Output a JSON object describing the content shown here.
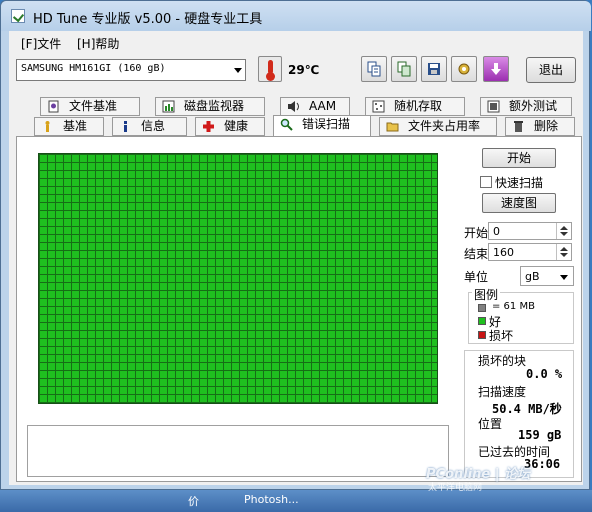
{
  "window": {
    "title": "HD Tune 专业版 v5.00 - 硬盘专业工具"
  },
  "menu": [
    {
      "label": "[F]文件"
    },
    {
      "label": "[H]帮助"
    }
  ],
  "toolbar": {
    "drive": "SAMSUNG HM161GI (160 gB)",
    "temperature": "29℃",
    "exit_label": "退出",
    "icons": [
      "copy-text-icon",
      "copy-screenshot-icon",
      "save-icon",
      "settings-icon",
      "download-icon"
    ]
  },
  "tabs": {
    "row1": [
      {
        "label": "文件基准",
        "icon": "file-benchmark-icon"
      },
      {
        "label": "磁盘监视器",
        "icon": "disk-monitor-icon"
      },
      {
        "label": "AAM",
        "icon": "speaker-icon"
      },
      {
        "label": "随机存取",
        "icon": "random-access-icon"
      },
      {
        "label": "额外测试",
        "icon": "extra-tests-icon"
      }
    ],
    "row2": [
      {
        "label": "基准",
        "icon": "benchmark-icon"
      },
      {
        "label": "信息",
        "icon": "info-icon"
      },
      {
        "label": "健康",
        "icon": "health-icon"
      },
      {
        "label": "错误扫描",
        "icon": "magnifier-icon",
        "active": true
      },
      {
        "label": "文件夹占用率",
        "icon": "folder-icon"
      },
      {
        "label": "删除",
        "icon": "trash-icon"
      }
    ]
  },
  "scan": {
    "start_button": "开始",
    "quick_scan_label": "快速扫描",
    "quick_scan_checked": false,
    "speed_map_button": "速度图",
    "start_label": "开始",
    "start_value": "0",
    "end_label": "结束",
    "end_value": "160",
    "unit_label": "单位",
    "unit_value": "gB",
    "legend_title": "图例",
    "legend_block": "= 61 MB",
    "legend_good": "好",
    "legend_bad": "损坏",
    "bad_blocks_label": "损坏的块",
    "bad_blocks_value": "0.0 %",
    "scan_speed_label": "扫描速度",
    "scan_speed_value": "50.4 MB/秒",
    "position_label": "位置",
    "position_value": "159 gB",
    "elapsed_label": "已过去的时间",
    "elapsed_value": "36:06",
    "colors": {
      "good": "#1fbf1f",
      "bad": "#c81414",
      "block": "#808080"
    }
  },
  "taskbar": {
    "items": [
      "价",
      "Photosh..."
    ]
  },
  "watermark": {
    "line1": "PConline | 论坛",
    "line2": "太平洋电脑网"
  }
}
